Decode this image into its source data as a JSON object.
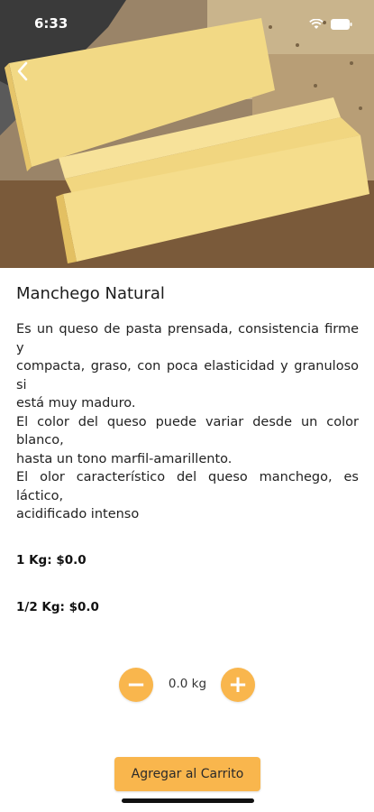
{
  "status_bar": {
    "time": "6:33"
  },
  "product": {
    "name": "Manchego Natural",
    "description_lines": [
      "Es un queso de pasta prensada, consistencia firme y",
      "compacta, graso, con poca elasticidad y granuloso si",
      "está muy maduro.",
      "El color del queso puede variar desde un color blanco,",
      "hasta un tono marfil-amarillento.",
      "El olor característico del queso manchego, es láctico,",
      "acidificado intenso"
    ],
    "price_1kg": "1 Kg:  $0.0",
    "price_half_kg": "1/2 Kg: $0.0"
  },
  "stepper": {
    "minus": "−",
    "plus": "+",
    "quantity": "0.0 kg"
  },
  "actions": {
    "add_to_cart": "Agregar al Carrito"
  },
  "colors": {
    "accent": "#f9b64d"
  },
  "icons": {
    "back": "chevron-left-icon",
    "wifi": "wifi-icon",
    "battery": "battery-icon"
  }
}
